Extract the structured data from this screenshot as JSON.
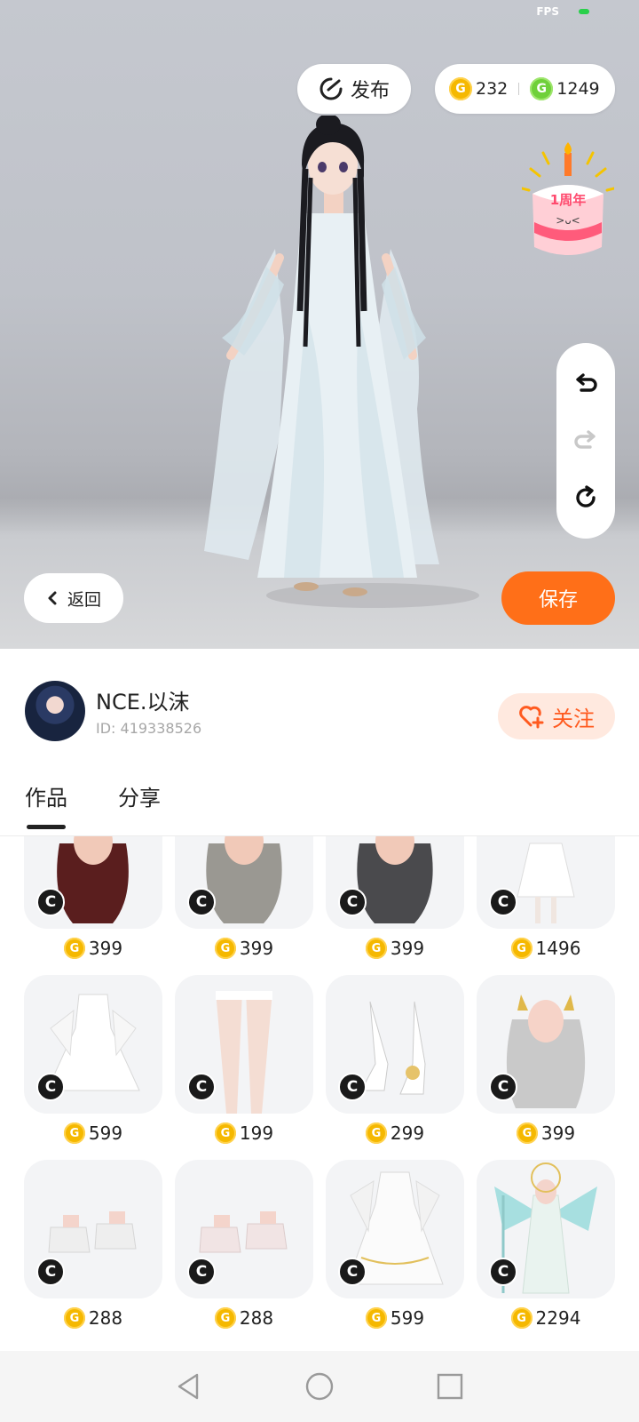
{
  "status": {
    "fps_label": "FPS"
  },
  "topbar": {
    "publish_label": "发布",
    "gold_coins": "232",
    "green_coins": "1249"
  },
  "event_badge": {
    "text": "1周年"
  },
  "tools": {
    "undo": "undo-icon",
    "redo": "redo-icon",
    "reset": "reset-icon"
  },
  "actions": {
    "back_label": "返回",
    "save_label": "保存"
  },
  "profile": {
    "name": "NCE.以沫",
    "id_text": "ID: 419338526",
    "follow_label": "关注"
  },
  "tabs": [
    {
      "label": "作品",
      "active": true
    },
    {
      "label": "分享",
      "active": false
    }
  ],
  "items": [
    {
      "name": "dark-red-hair",
      "price": "399"
    },
    {
      "name": "grey-wavy-hair",
      "price": "399"
    },
    {
      "name": "dark-grey-hair",
      "price": "399"
    },
    {
      "name": "white-outfit-set",
      "price": "1496"
    },
    {
      "name": "white-lace-dress",
      "price": "599"
    },
    {
      "name": "white-stockings",
      "price": "199"
    },
    {
      "name": "white-heels",
      "price": "299"
    },
    {
      "name": "silver-hair-horns",
      "price": "399"
    },
    {
      "name": "white-platform-shoes",
      "price": "288"
    },
    {
      "name": "pink-platform-shoes",
      "price": "288"
    },
    {
      "name": "white-gold-gown",
      "price": "599"
    },
    {
      "name": "celestial-outfit",
      "price": "2294"
    }
  ],
  "colors": {
    "accent": "#ff6f18",
    "follow_text": "#ff5a1f",
    "gold": "#f5b800",
    "green": "#6fd03a"
  }
}
